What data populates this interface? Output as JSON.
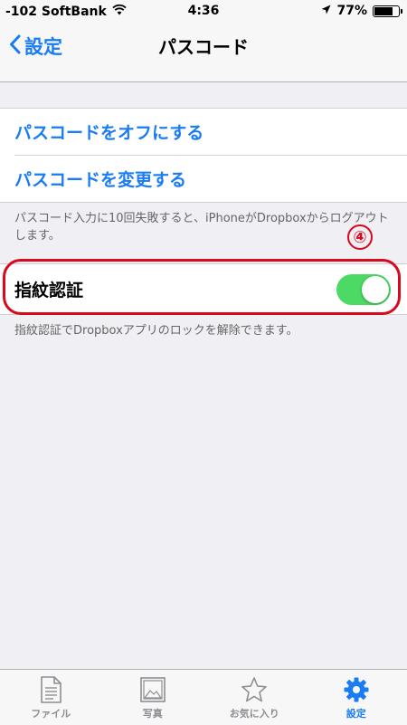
{
  "status_bar": {
    "carrier": "-102 SoftBank",
    "time": "4:36",
    "battery_percent": "77%",
    "battery_level": 0.77,
    "icons": [
      "wifi-icon",
      "location-arrow-icon",
      "battery-icon"
    ]
  },
  "nav": {
    "back_label": "設定",
    "title": "パスコード"
  },
  "passcode_group": {
    "turn_off_label": "パスコードをオフにする",
    "change_label": "パスコードを変更する"
  },
  "passcode_footer": "パスコード入力に10回失敗すると、iPhoneがDropboxからログアウトします。",
  "fingerprint": {
    "label": "指紋認証",
    "enabled": true,
    "footer": "指紋認証でDropboxアプリのロックを解除できます。"
  },
  "annotation": {
    "number": "④",
    "color": "#d8091c"
  },
  "tabs": [
    {
      "label": "ファイル",
      "icon": "file-icon",
      "active": false
    },
    {
      "label": "写真",
      "icon": "photo-icon",
      "active": false
    },
    {
      "label": "お気に入り",
      "icon": "star-icon",
      "active": false
    },
    {
      "label": "設定",
      "icon": "gear-icon",
      "active": true
    }
  ],
  "colors": {
    "accent": "#1a7cf5",
    "toggle_on": "#4cd964",
    "background": "#efeff4"
  }
}
